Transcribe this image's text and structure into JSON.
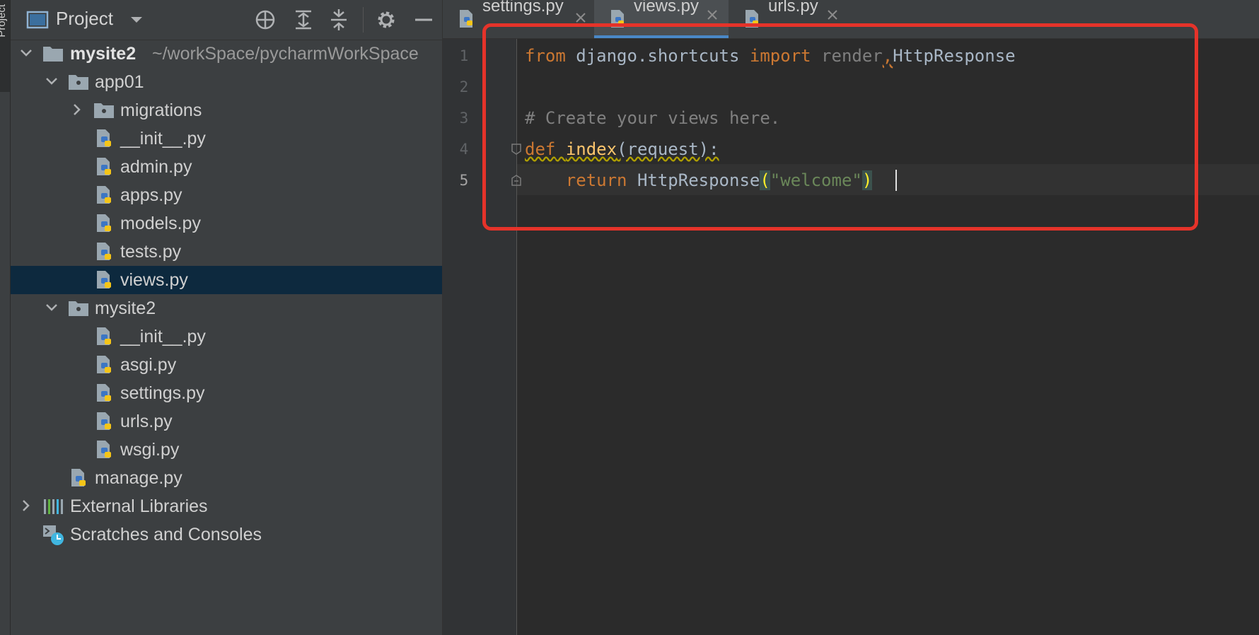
{
  "side_strip": {
    "label": "Project"
  },
  "project_panel": {
    "title": "Project",
    "tree": [
      {
        "id": "root",
        "label": "mysite2",
        "path": "~/workSpace/pycharmWorkSpace"
      },
      {
        "id": "app01",
        "label": "app01"
      },
      {
        "id": "migrations",
        "label": "migrations"
      },
      {
        "id": "init1",
        "label": "__init__.py"
      },
      {
        "id": "admin",
        "label": "admin.py"
      },
      {
        "id": "apps",
        "label": "apps.py"
      },
      {
        "id": "models",
        "label": "models.py"
      },
      {
        "id": "tests",
        "label": "tests.py"
      },
      {
        "id": "views",
        "label": "views.py"
      },
      {
        "id": "mysite2pkg",
        "label": "mysite2"
      },
      {
        "id": "init2",
        "label": "__init__.py"
      },
      {
        "id": "asgi",
        "label": "asgi.py"
      },
      {
        "id": "settings",
        "label": "settings.py"
      },
      {
        "id": "urls",
        "label": "urls.py"
      },
      {
        "id": "wsgi",
        "label": "wsgi.py"
      },
      {
        "id": "manage",
        "label": "manage.py"
      },
      {
        "id": "extlibs",
        "label": "External Libraries"
      },
      {
        "id": "scratches",
        "label": "Scratches and Consoles"
      }
    ]
  },
  "editor": {
    "tabs": [
      {
        "label": "settings.py"
      },
      {
        "label": "views.py",
        "active": true
      },
      {
        "label": "urls.py"
      }
    ],
    "line_numbers": [
      "1",
      "2",
      "3",
      "4",
      "5"
    ],
    "code": {
      "l1": {
        "kw_from": "from",
        "module": "django.shortcuts",
        "kw_import": "import",
        "unused": "render",
        "comma": ",",
        "name": "HttpResponse"
      },
      "l3": {
        "comment": "# Create your views here."
      },
      "l4": {
        "kw_def": "def",
        "fn": "index",
        "rest": "(request):"
      },
      "l5": {
        "indent": "    ",
        "kw_return": "return",
        "call": "HttpResponse",
        "open": "(",
        "str": "\"welcome\"",
        "close": ")"
      }
    }
  },
  "colors": {
    "keyword": "#cc7832",
    "function": "#ffc66d",
    "string": "#6a8759",
    "comment": "#808080",
    "highlight_box": "#e5332a",
    "selection": "#0d293e",
    "tab_underline": "#4a88c7"
  },
  "icons": {
    "panel": "project-view-icon",
    "locate": "locate-icon",
    "expand": "expand-all-icon",
    "collapse": "collapse-all-icon",
    "settings": "gear-icon",
    "hide": "minimize-icon",
    "python_file": "python-file-icon",
    "folder": "folder-icon",
    "libraries": "library-icon",
    "scratches": "scratches-icon"
  }
}
